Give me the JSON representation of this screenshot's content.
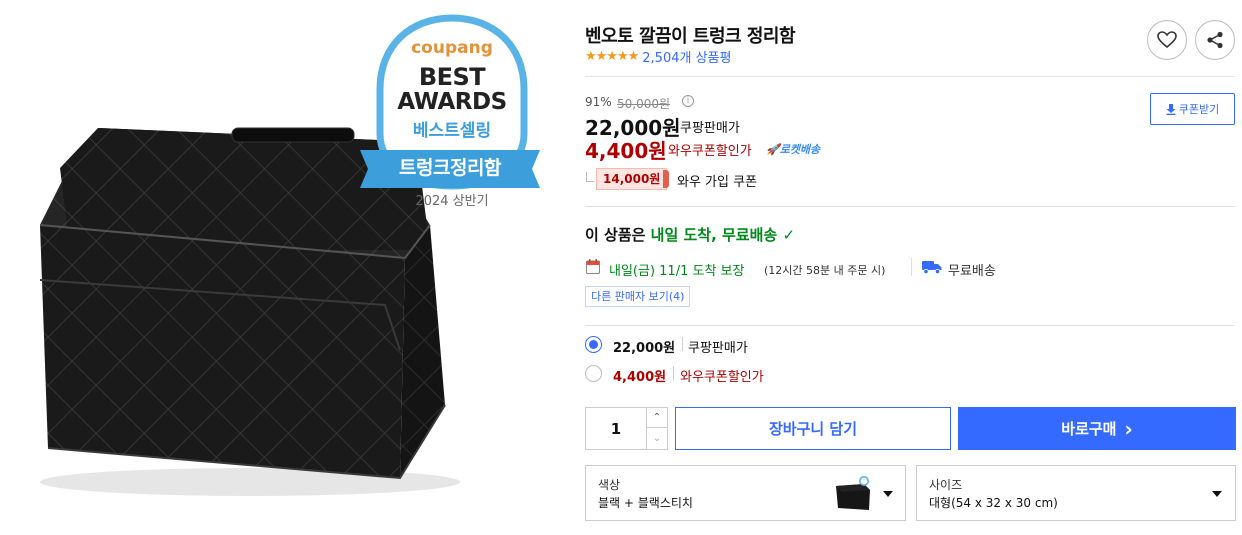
{
  "badge": {
    "brand": "coupang",
    "line1": "BEST",
    "line2": "AWARDS",
    "korean": "베스트셀링",
    "category": "트렁크정리함",
    "period": "2024 상반기"
  },
  "product": {
    "title": "벤오토 깔끔이 트렁크 정리함",
    "stars": "★★★★★",
    "rating": 4.5,
    "review_count": "2,504개 상품평"
  },
  "pricing": {
    "discount_rate": "91%",
    "original_price": "50,000원",
    "info_icon": "i",
    "coupang_price": "22,000원",
    "coupang_price_label": "쿠팡판매가",
    "wow_price": "4,400원",
    "wow_price_label": "와우쿠폰할인가",
    "rocket_label": "🚀로켓배송",
    "coupon_button": "쿠폰받기",
    "coupon_tag": "14,000원",
    "coupon_tag_label": "와우 가입 쿠폰"
  },
  "delivery": {
    "headline_prefix": "이 상품은 ",
    "headline_green": "내일 도착, 무료배송",
    "check": "✓",
    "date": "내일(금) 11/1 도착 보장",
    "cutoff": "(12시간 58분 내 주문 시)",
    "free_shipping": "무료배송",
    "other_sellers": "다른 판매자 보기(4)"
  },
  "price_options": [
    {
      "price": "22,000원",
      "label": "쿠팡판매가",
      "selected": true
    },
    {
      "price": "4,400원",
      "label": "와우쿠폰할인가",
      "selected": false
    }
  ],
  "purchase": {
    "quantity": "1",
    "qty_up": "⌃",
    "qty_down": "⌄",
    "cart_button": "장바구니 담기",
    "buy_button": "바로구매",
    "buy_arrow": "›"
  },
  "options": {
    "color_label": "색상",
    "color_value": "블랙 + 블랙스티치",
    "size_label": "사이즈",
    "size_value": "대형(54 x 32 x 30 cm)"
  },
  "icons": {
    "wishlist": "heart-icon",
    "share": "share-icon",
    "coupon_download": "download-icon",
    "calendar": "calendar-icon",
    "truck": "truck-icon"
  },
  "colors": {
    "accent": "#346aff",
    "wow_red": "#ae0000",
    "delivery_green": "#00891a",
    "star": "#f39a1c"
  }
}
